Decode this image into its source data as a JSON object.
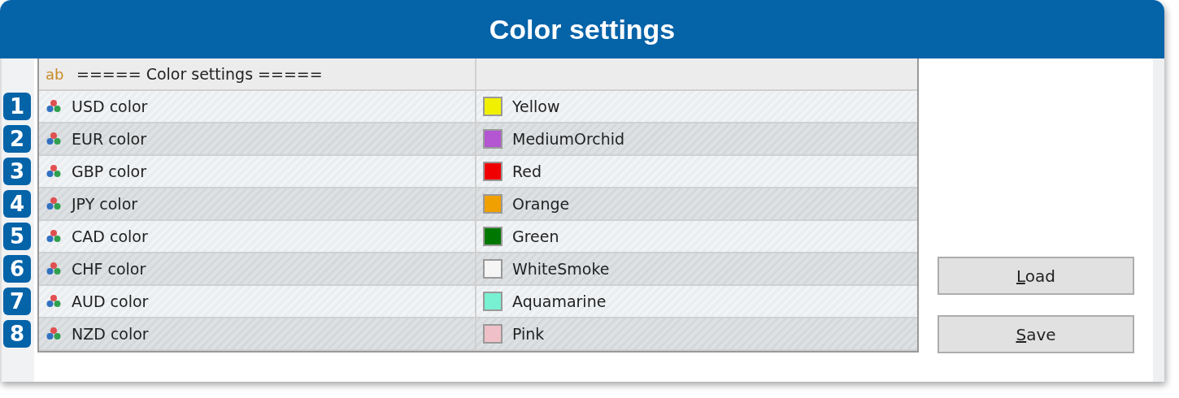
{
  "window": {
    "title": "Color settings"
  },
  "table": {
    "header": {
      "icon": "ab",
      "label": "===== Color settings ====="
    },
    "rows": [
      {
        "number": "1",
        "name": "USD color",
        "value": "Yellow",
        "color": "#f0f000"
      },
      {
        "number": "2",
        "name": "EUR color",
        "value": "MediumOrchid",
        "color": "#b455d2"
      },
      {
        "number": "3",
        "name": "GBP color",
        "value": "Red",
        "color": "#f00000"
      },
      {
        "number": "4",
        "name": "JPY color",
        "value": "Orange",
        "color": "#f0a000"
      },
      {
        "number": "5",
        "name": "CAD color",
        "value": "Green",
        "color": "#007800"
      },
      {
        "number": "6",
        "name": "CHF color",
        "value": "WhiteSmoke",
        "color": "#f5f5f5"
      },
      {
        "number": "7",
        "name": "AUD color",
        "value": "Aquamarine",
        "color": "#78f0d2"
      },
      {
        "number": "8",
        "name": "NZD color",
        "value": "Pink",
        "color": "#f0c0c8"
      }
    ]
  },
  "buttons": [
    {
      "label": "Load"
    },
    {
      "label": "Save"
    }
  ]
}
